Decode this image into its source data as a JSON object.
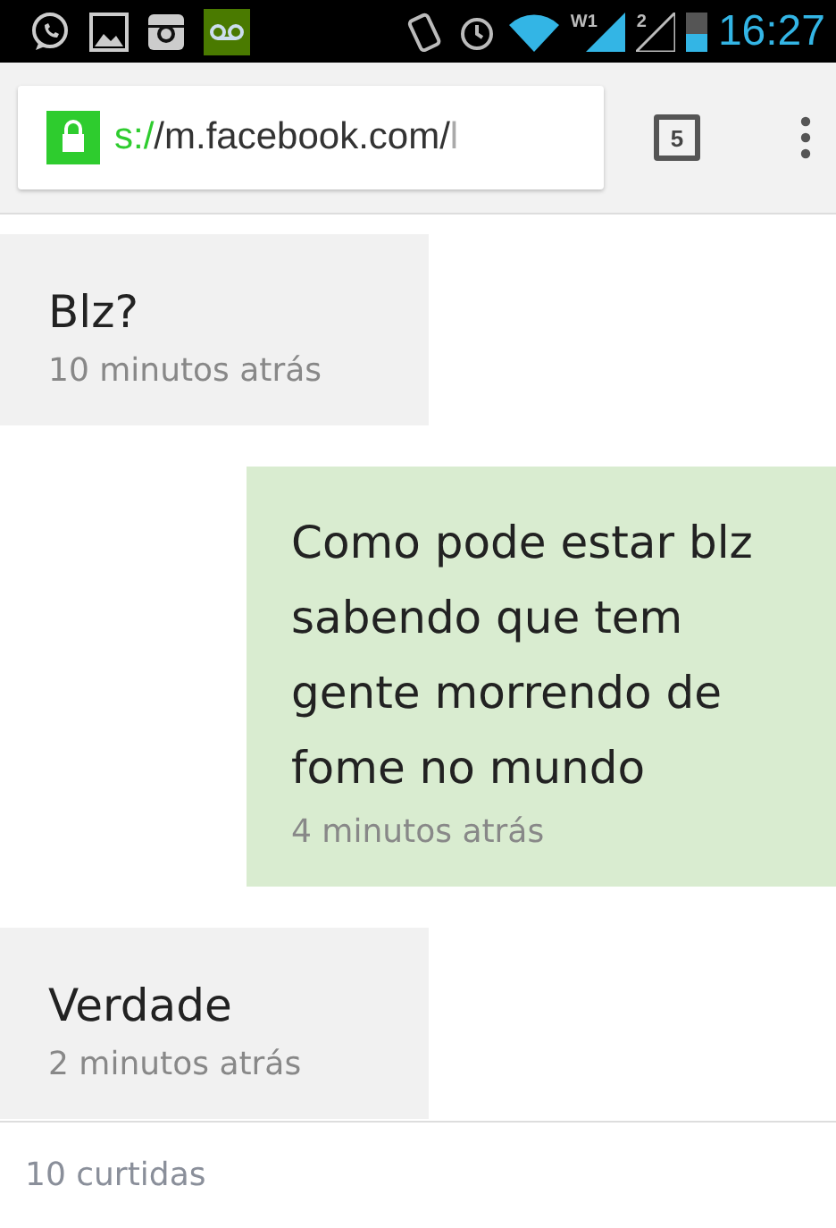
{
  "status_bar": {
    "time": "16:27",
    "network_1": "W1",
    "network_2": "2"
  },
  "browser": {
    "url_scheme": "s:/",
    "url_host": "/m.facebook.com/",
    "url_rest": "l",
    "tab_count": "5"
  },
  "messages": [
    {
      "kind": "received",
      "text": "Blz?",
      "time": "10 minutos atrás"
    },
    {
      "kind": "sent",
      "text": "Como pode estar blz sabendo que tem gente morrendo de fome no mundo",
      "time": "4 minutos atrás"
    },
    {
      "kind": "received",
      "text": "Verdade",
      "time": "2 minutos atrás"
    }
  ],
  "footer": {
    "likes": "10 curtidas"
  }
}
